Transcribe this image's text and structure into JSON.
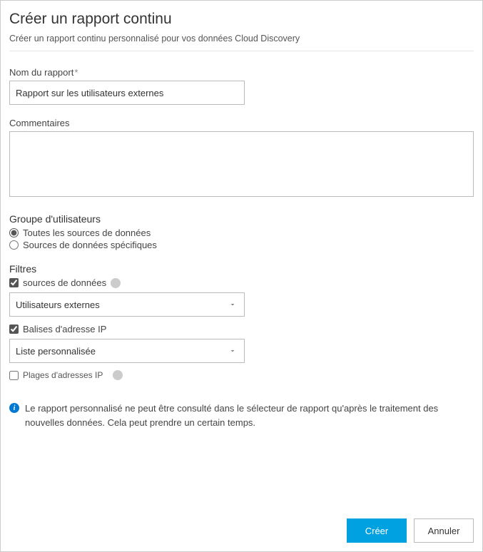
{
  "header": {
    "title": "Créer un rapport continu",
    "subtitle": "Créer un rapport continu personnalisé pour vos données Cloud Discovery"
  },
  "fields": {
    "reportName": {
      "label": "Nom du rapport",
      "required_mark": "*",
      "value": "Rapport sur les utilisateurs externes"
    },
    "comments": {
      "label": "Commentaires",
      "value": ""
    }
  },
  "userGroup": {
    "label": "Groupe d'utilisateurs",
    "options": {
      "all": "Toutes les sources de données",
      "specific": "Sources de données spécifiques"
    },
    "selected": "all"
  },
  "filters": {
    "label": "Filtres",
    "dataSources": {
      "checkbox_label": "sources de données",
      "checked": true,
      "selected": "Utilisateurs externes"
    },
    "ipTags": {
      "checkbox_label": "Balises d'adresse IP",
      "checked": true,
      "selected": "Liste personnalisée"
    },
    "ipRanges": {
      "checkbox_label": "Plages d'adresses IP",
      "checked": false
    }
  },
  "info": {
    "text": "Le rapport personnalisé ne peut être consulté dans le sélecteur de rapport qu'après le traitement des nouvelles données. Cela peut prendre un certain temps."
  },
  "buttons": {
    "create": "Créer",
    "cancel": "Annuler"
  }
}
